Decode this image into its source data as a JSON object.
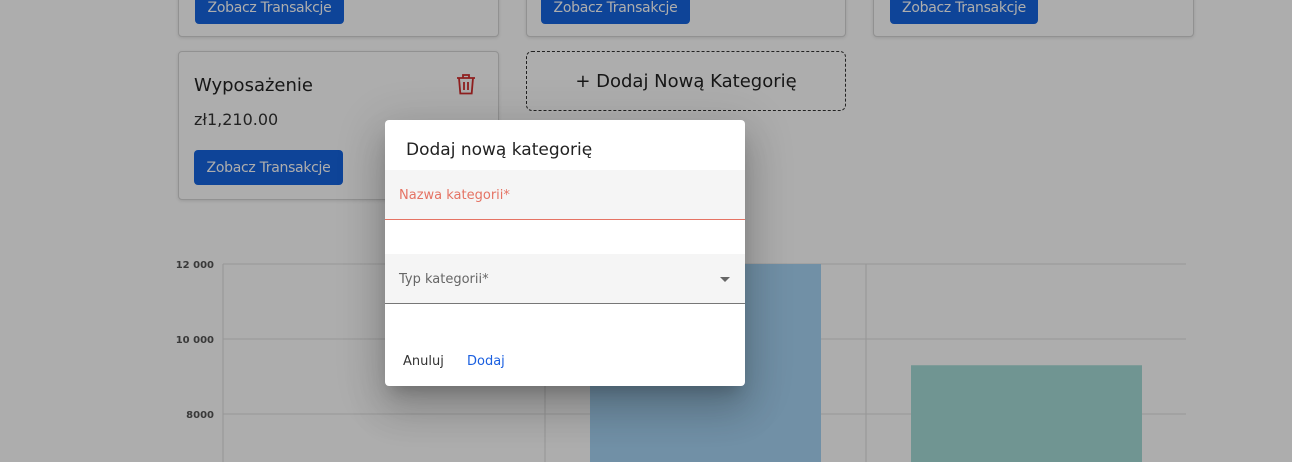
{
  "categories": [
    {
      "title": "",
      "amount": "",
      "button_label": "Zobacz Transakcje"
    },
    {
      "title": "",
      "amount": "",
      "button_label": "Zobacz Transakcje"
    },
    {
      "title": "",
      "amount": "",
      "button_label": "Zobacz Transakcje"
    },
    {
      "title": "Wyposażenie",
      "amount": "zł1,210.00",
      "button_label": "Zobacz Transakcje"
    }
  ],
  "add_category_label": "+ Dodaj Nową Kategorię",
  "colors": {
    "primary": "#1565e0",
    "danger": "#d32f2f",
    "error": "#e57364",
    "bar_blue": "#a7d4f5",
    "bar_teal": "#a6dcd8"
  },
  "chart_data": {
    "type": "bar",
    "categories": [
      "",
      "",
      ""
    ],
    "series": [
      {
        "values": [
          null,
          12000,
          9300
        ]
      }
    ],
    "yticks": [
      "12 000",
      "10 000",
      "8000"
    ],
    "ylim": [
      7200,
      12600
    ],
    "grid": true
  },
  "dialog": {
    "title": "Dodaj nową kategorię",
    "name_label": "Nazwa kategorii*",
    "type_label": "Typ kategorii*",
    "cancel_label": "Anuluj",
    "add_label": "Dodaj"
  }
}
